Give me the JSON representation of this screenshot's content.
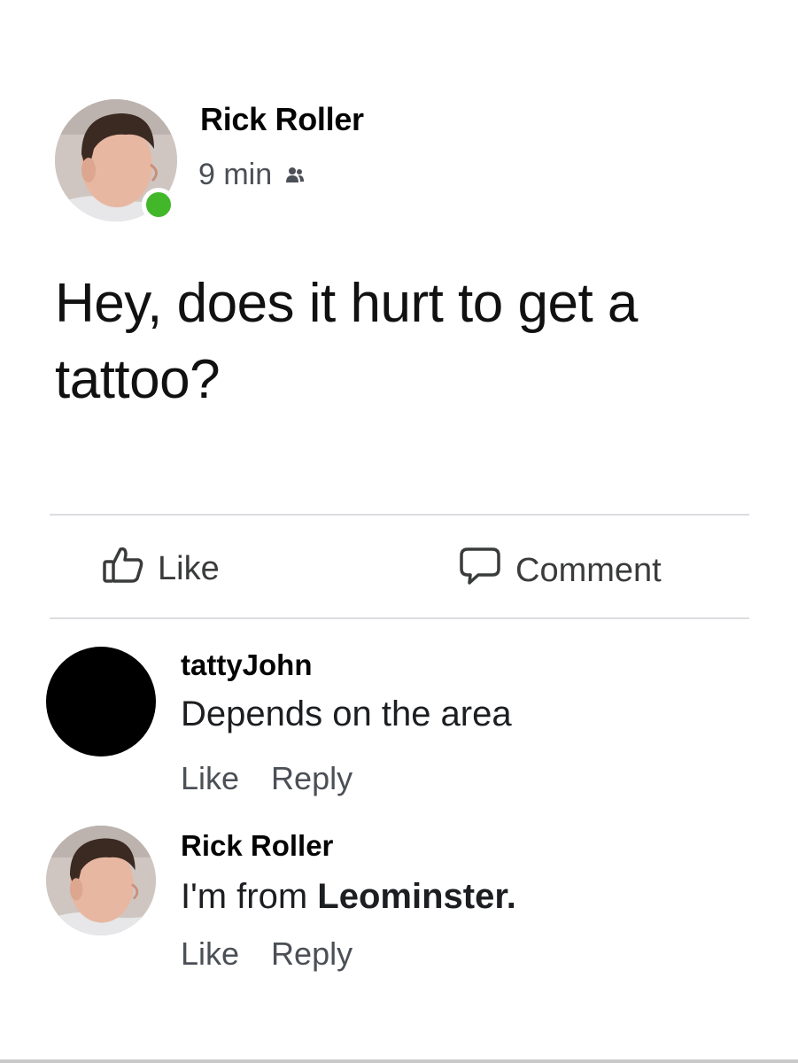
{
  "post": {
    "author": "Rick Roller",
    "time": "9 min",
    "audience_icon": "friends-icon",
    "text": "Hey, does it hurt to get a tattoo?",
    "online": true
  },
  "actions": {
    "like_label": "Like",
    "comment_label": "Comment",
    "like_icon": "thumbs-up-icon",
    "comment_icon": "speech-bubble-icon"
  },
  "comments": [
    {
      "author": "tattyJohn",
      "text": "Depends on the area",
      "like_label": "Like",
      "reply_label": "Reply"
    },
    {
      "author": "Rick Roller",
      "text_prefix": "I'm from ",
      "text_bold": "Leominster.",
      "like_label": "Like",
      "reply_label": "Reply"
    }
  ],
  "colors": {
    "online": "#42b72a",
    "text": "#1c1e21",
    "secondary": "#4b4f56",
    "divider": "#dcdde1"
  }
}
